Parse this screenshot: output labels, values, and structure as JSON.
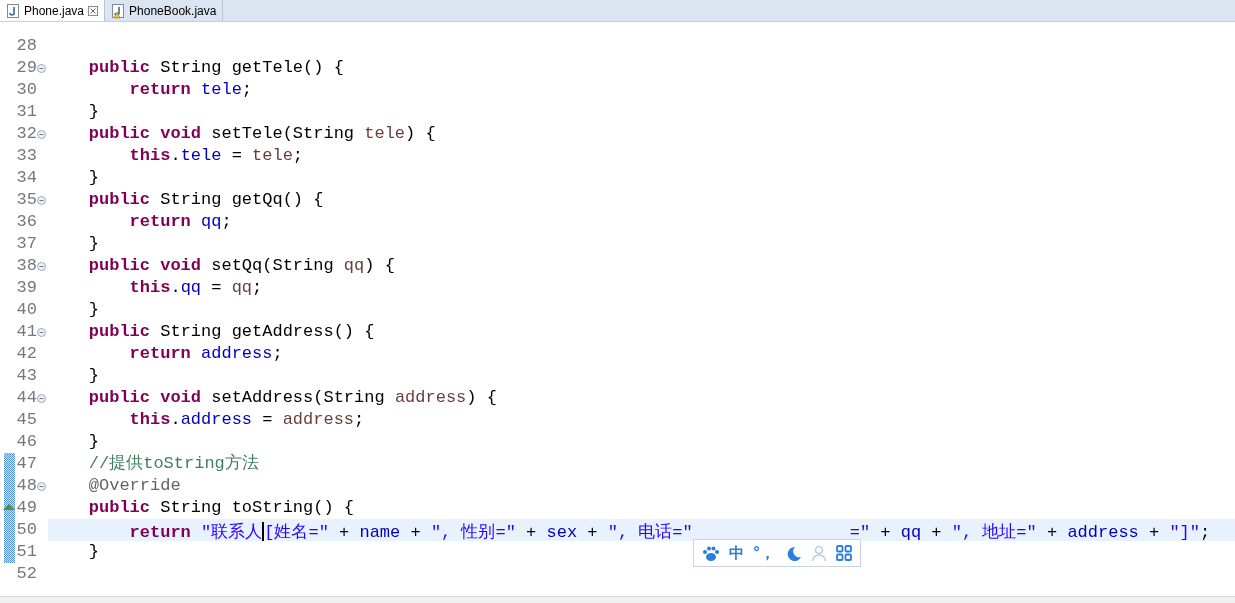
{
  "tabs": [
    {
      "label": "Phone.java",
      "selected": true,
      "kind": "file",
      "closable": true
    },
    {
      "label": "PhoneBook.java",
      "selected": false,
      "kind": "warning",
      "closable": false
    }
  ],
  "editor": {
    "lines": [
      {
        "number": "28",
        "foldable": false,
        "changed": false,
        "override": false,
        "current": false
      },
      {
        "number": "29",
        "foldable": true,
        "changed": false,
        "override": false,
        "current": false,
        "code": [
          {
            "kind": "kw",
            "text": "    public"
          },
          {
            "kind": "plain",
            "text": " String getTele() {"
          }
        ]
      },
      {
        "number": "30",
        "foldable": false,
        "changed": false,
        "override": false,
        "current": false,
        "code": [
          {
            "kind": "kw",
            "text": "        return "
          },
          {
            "kind": "field",
            "text": "tele"
          },
          {
            "kind": "plain",
            "text": ";"
          }
        ]
      },
      {
        "number": "31",
        "foldable": false,
        "changed": false,
        "override": false,
        "current": false,
        "code": [
          {
            "kind": "plain",
            "text": "    }"
          }
        ]
      },
      {
        "number": "32",
        "foldable": true,
        "changed": false,
        "override": false,
        "current": false,
        "code": [
          {
            "kind": "kw",
            "text": "    public void"
          },
          {
            "kind": "plain",
            "text": " setTele(String "
          },
          {
            "kind": "param",
            "text": "tele"
          },
          {
            "kind": "plain",
            "text": ") {"
          }
        ]
      },
      {
        "number": "33",
        "foldable": false,
        "changed": false,
        "override": false,
        "current": false,
        "code": [
          {
            "kind": "kw",
            "text": "        this"
          },
          {
            "kind": "plain",
            "text": "."
          },
          {
            "kind": "field",
            "text": "tele"
          },
          {
            "kind": "plain",
            "text": " = "
          },
          {
            "kind": "param",
            "text": "tele"
          },
          {
            "kind": "plain",
            "text": ";"
          }
        ]
      },
      {
        "number": "34",
        "foldable": false,
        "changed": false,
        "override": false,
        "current": false,
        "code": [
          {
            "kind": "plain",
            "text": "    }"
          }
        ]
      },
      {
        "number": "35",
        "foldable": true,
        "changed": false,
        "override": false,
        "current": false,
        "code": [
          {
            "kind": "kw",
            "text": "    public"
          },
          {
            "kind": "plain",
            "text": " String getQq() {"
          }
        ]
      },
      {
        "number": "36",
        "foldable": false,
        "changed": false,
        "override": false,
        "current": false,
        "code": [
          {
            "kind": "kw",
            "text": "        return "
          },
          {
            "kind": "field",
            "text": "qq"
          },
          {
            "kind": "plain",
            "text": ";"
          }
        ]
      },
      {
        "number": "37",
        "foldable": false,
        "changed": false,
        "override": false,
        "current": false,
        "code": [
          {
            "kind": "plain",
            "text": "    }"
          }
        ]
      },
      {
        "number": "38",
        "foldable": true,
        "changed": false,
        "override": false,
        "current": false,
        "code": [
          {
            "kind": "kw",
            "text": "    public void"
          },
          {
            "kind": "plain",
            "text": " setQq(String "
          },
          {
            "kind": "param",
            "text": "qq"
          },
          {
            "kind": "plain",
            "text": ") {"
          }
        ]
      },
      {
        "number": "39",
        "foldable": false,
        "changed": false,
        "override": false,
        "current": false,
        "code": [
          {
            "kind": "kw",
            "text": "        this"
          },
          {
            "kind": "plain",
            "text": "."
          },
          {
            "kind": "field",
            "text": "qq"
          },
          {
            "kind": "plain",
            "text": " = "
          },
          {
            "kind": "param",
            "text": "qq"
          },
          {
            "kind": "plain",
            "text": ";"
          }
        ]
      },
      {
        "number": "40",
        "foldable": false,
        "changed": false,
        "override": false,
        "current": false,
        "code": [
          {
            "kind": "plain",
            "text": "    }"
          }
        ]
      },
      {
        "number": "41",
        "foldable": true,
        "changed": false,
        "override": false,
        "current": false,
        "code": [
          {
            "kind": "kw",
            "text": "    public"
          },
          {
            "kind": "plain",
            "text": " String getAddress() {"
          }
        ]
      },
      {
        "number": "42",
        "foldable": false,
        "changed": false,
        "override": false,
        "current": false,
        "code": [
          {
            "kind": "kw",
            "text": "        return "
          },
          {
            "kind": "field",
            "text": "address"
          },
          {
            "kind": "plain",
            "text": ";"
          }
        ]
      },
      {
        "number": "43",
        "foldable": false,
        "changed": false,
        "override": false,
        "current": false,
        "code": [
          {
            "kind": "plain",
            "text": "    }"
          }
        ]
      },
      {
        "number": "44",
        "foldable": true,
        "changed": false,
        "override": false,
        "current": false,
        "code": [
          {
            "kind": "kw",
            "text": "    public void"
          },
          {
            "kind": "plain",
            "text": " setAddress(String "
          },
          {
            "kind": "param",
            "text": "address"
          },
          {
            "kind": "plain",
            "text": ") {"
          }
        ]
      },
      {
        "number": "45",
        "foldable": false,
        "changed": false,
        "override": false,
        "current": false,
        "code": [
          {
            "kind": "kw",
            "text": "        this"
          },
          {
            "kind": "plain",
            "text": "."
          },
          {
            "kind": "field",
            "text": "address"
          },
          {
            "kind": "plain",
            "text": " = "
          },
          {
            "kind": "param",
            "text": "address"
          },
          {
            "kind": "plain",
            "text": ";"
          }
        ]
      },
      {
        "number": "46",
        "foldable": false,
        "changed": false,
        "override": false,
        "current": false,
        "code": [
          {
            "kind": "plain",
            "text": "    }"
          }
        ]
      },
      {
        "number": "47",
        "foldable": false,
        "changed": true,
        "override": false,
        "current": false,
        "code": [
          {
            "kind": "comment",
            "text": "    //提供toString方法"
          }
        ]
      },
      {
        "number": "48",
        "foldable": true,
        "changed": true,
        "override": false,
        "current": false,
        "code": [
          {
            "kind": "annot",
            "text": "    @Override"
          }
        ]
      },
      {
        "number": "49",
        "foldable": false,
        "changed": true,
        "override": true,
        "current": false,
        "code": [
          {
            "kind": "kw",
            "text": "    public"
          },
          {
            "kind": "plain",
            "text": " String toString() {"
          }
        ]
      },
      {
        "number": "50",
        "foldable": false,
        "changed": true,
        "override": false,
        "current": true,
        "code": [
          {
            "kind": "kw",
            "text": "        return "
          },
          {
            "kind": "str",
            "text": "\"联系人"
          },
          {
            "kind": "caret"
          },
          {
            "kind": "str",
            "text": "[姓名=\""
          },
          {
            "kind": "plain",
            "text": " + "
          },
          {
            "kind": "field",
            "text": "name"
          },
          {
            "kind": "plain",
            "text": " + "
          },
          {
            "kind": "str",
            "text": "\", 性别=\""
          },
          {
            "kind": "plain",
            "text": " + "
          },
          {
            "kind": "field",
            "text": "sex"
          },
          {
            "kind": "plain",
            "text": " + "
          },
          {
            "kind": "str",
            "text": "\", 电话=\""
          },
          {
            "kind": "ime"
          },
          {
            "kind": "str",
            "text": "=\""
          },
          {
            "kind": "plain",
            "text": " + "
          },
          {
            "kind": "field",
            "text": "qq"
          },
          {
            "kind": "plain",
            "text": " + "
          },
          {
            "kind": "str",
            "text": "\", 地址=\""
          },
          {
            "kind": "plain",
            "text": " + "
          },
          {
            "kind": "field",
            "text": "address"
          },
          {
            "kind": "plain",
            "text": " + "
          },
          {
            "kind": "str",
            "text": "\"]\""
          },
          {
            "kind": "plain",
            "text": ";"
          }
        ]
      },
      {
        "number": "51",
        "foldable": false,
        "changed": true,
        "override": false,
        "current": false,
        "code": [
          {
            "kind": "plain",
            "text": "    }"
          }
        ]
      },
      {
        "number": "52",
        "foldable": false,
        "changed": false,
        "override": false,
        "current": false
      }
    ]
  },
  "ime_toolbar": {
    "items": [
      {
        "kind": "paw",
        "disabled": false
      },
      {
        "kind": "text",
        "text": "中",
        "disabled": false
      },
      {
        "kind": "text",
        "text": "°，",
        "disabled": false
      },
      {
        "kind": "moon",
        "disabled": false
      },
      {
        "kind": "user",
        "disabled": true
      },
      {
        "kind": "grid",
        "disabled": false
      }
    ]
  }
}
